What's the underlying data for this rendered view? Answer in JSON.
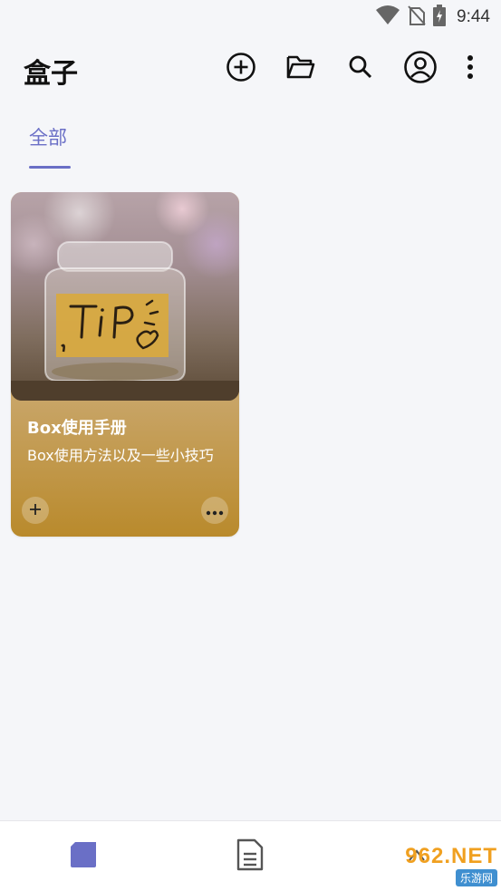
{
  "status_bar": {
    "time": "9:44",
    "icons": [
      "wifi-icon",
      "no-sim-icon",
      "battery-charging-icon"
    ]
  },
  "app_bar": {
    "title": "盒子",
    "actions": [
      "add-circle-icon",
      "folder-open-icon",
      "search-icon",
      "account-icon",
      "more-vert-icon"
    ]
  },
  "tabs": [
    {
      "label": "全部",
      "selected": true
    }
  ],
  "cards": [
    {
      "title": "Box使用手册",
      "description": "Box使用方法以及一些小技巧",
      "image": "tip-jar-photo",
      "image_text": "TiP"
    }
  ],
  "bottom_nav": {
    "items": [
      "boxes-nav-icon",
      "document-nav-icon",
      "third-nav-icon"
    ],
    "active_index": 0
  },
  "watermark": {
    "main": "962.NET",
    "sub": "乐游网"
  },
  "colors": {
    "accent": "#6a6fc6",
    "background": "#f5f6f9",
    "card_gold": "#c9a66a"
  }
}
